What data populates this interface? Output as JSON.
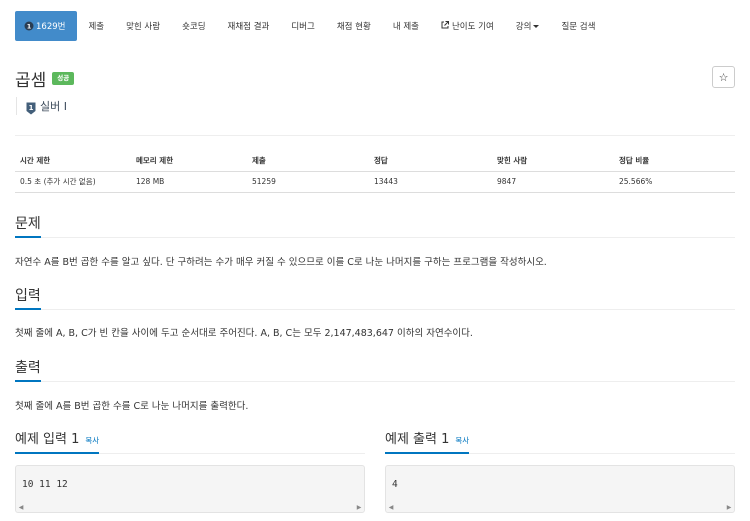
{
  "nav": {
    "problem_number": "1629번",
    "submit": "제출",
    "solved_users": "맞힌 사람",
    "short_coding": "숏코딩",
    "judge_results": "재채점 결과",
    "debug": "디버그",
    "status": "채점 현황",
    "my_submissions": "내 제출",
    "difficulty_contribution": "난이도 기여",
    "lecture": "강의",
    "question_search": "질문 검색"
  },
  "header": {
    "title": "곱셈",
    "result_badge": "성공",
    "star_icon": "☆",
    "tier_label": "실버 I",
    "tier_number": "1"
  },
  "info": {
    "headers": [
      "시간 제한",
      "메모리 제한",
      "제출",
      "정답",
      "맞힌 사람",
      "정답 비율"
    ],
    "values": [
      "0.5 초 (추가 시간 없음)",
      "128 MB",
      "51259",
      "13443",
      "9847",
      "25.566%"
    ]
  },
  "sections": {
    "problem": {
      "title": "문제",
      "body": "자연수 A를 B번 곱한 수를 알고 싶다. 단 구하려는 수가 매우 커질 수 있으므로 이를 C로 나눈 나머지를 구하는 프로그램을 작성하시오."
    },
    "input": {
      "title": "입력",
      "body": "첫째 줄에 A, B, C가 빈 칸을 사이에 두고 순서대로 주어진다. A, B, C는 모두 2,147,483,647 이하의 자연수이다."
    },
    "output": {
      "title": "출력",
      "body": "첫째 줄에 A를 B번 곱한 수를 C로 나눈 나머지를 출력한다."
    }
  },
  "samples": {
    "input_title": "예제 입력 1",
    "output_title": "예제 출력 1",
    "copy_label": "복사",
    "input_value": "10 11 12",
    "output_value": "4"
  },
  "colors": {
    "primary": "#428bca",
    "success": "#5cb85c",
    "link": "#0076c0"
  }
}
